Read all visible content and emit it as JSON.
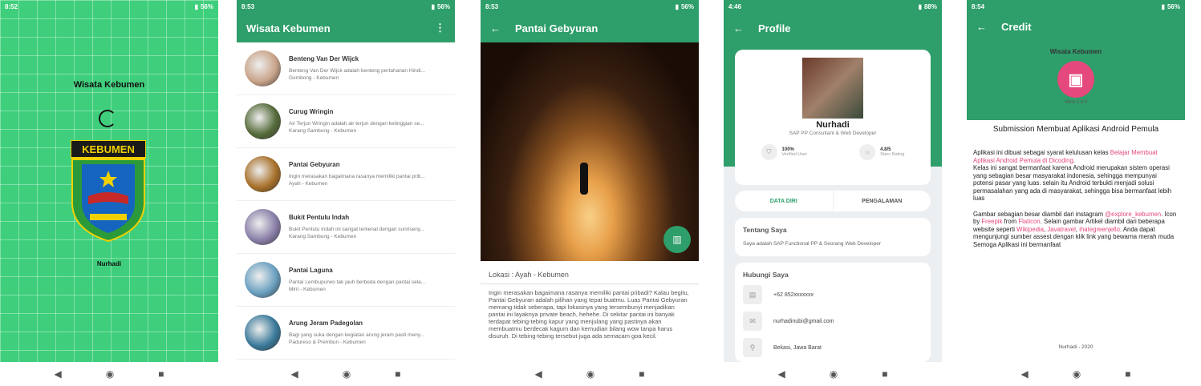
{
  "splash": {
    "status": {
      "time": "8:52",
      "battery": "56%"
    },
    "title": "Wisata Kebumen",
    "logo_text": "KEBUMEN",
    "author": "Nurhadi"
  },
  "list": {
    "status": {
      "time": "8:53",
      "battery": "56%"
    },
    "title": "Wisata Kebumen",
    "items": [
      {
        "title": "Benteng Van Der Wijck",
        "desc": "Benteng Van Der Wijck adalah benteng pertahanan Hindi...",
        "loc": "Gombong - Kebumen",
        "color": "#c9a48a"
      },
      {
        "title": "Curug Wringin",
        "desc": "Air Terjun Wringin adalah air terjun dengan ketinggian se...",
        "loc": "Karang Sambung - Kebumen",
        "color": "#556b3a"
      },
      {
        "title": "Pantai Gebyuran",
        "desc": "Ingin merasakan bagaimana rasanya memiliki pantai prib...",
        "loc": "Ayah - Kebumen",
        "color": "#a8702a"
      },
      {
        "title": "Bukit Pentulu Indah",
        "desc": "Bukit Pentulu Indah ini sangat terkenal dengan sunriseny...",
        "loc": "Karang Sambung - Kebumen",
        "color": "#8a7fa8"
      },
      {
        "title": "Pantai Laguna",
        "desc": "Pantai Lembupurwo tak jauh berbeda dengan pantai sela...",
        "loc": "Mirit - Kebumen",
        "color": "#6aa0c0"
      },
      {
        "title": "Arung Jeram Padegolan",
        "desc": "Bagi yang suka dengan kegiatan arung jeram pasti meny...",
        "loc": "Padureso & Prembun - Kebumen",
        "color": "#3a7a9a"
      }
    ]
  },
  "detail": {
    "status": {
      "time": "8:53",
      "battery": "56%"
    },
    "title": "Pantai Gebyuran",
    "location": "Lokasi : Ayah - Kebumen",
    "description": "Ingin merasakan bagaimana rasanya memiliki pantai pribadi? Kalau begitu, Pantai Gebyuran adalah pilihan yang tepat buatmu. Luas Pantai Gebyuran memang tidak seberapa, tapi lokasinya yang tersembunyi menjadikan pantai ini layaknya private beach, hehehe. Di sekitar pantai ini banyak terdapat tebing-tebing kapur yang menjulang yang pastinya akan membuatmu berdecak kagum dan kemudian bilang wow tanpa harus disuruh. Di tebing-tebing tersebut juga ada semacam goa kecil."
  },
  "profile": {
    "status": {
      "time": "4:46",
      "battery": "88%"
    },
    "title": "Profile",
    "name": "Nurhadi",
    "role": "SAP PP Consultant & Web Developer",
    "stat1_value": "100%",
    "stat1_label": "Verified User",
    "stat2_value": "4.8/5",
    "stat2_label": "Stars Rating",
    "tab1": "DATA DIRI",
    "tab2": "PENGALAMAN",
    "about_title": "Tentang Saya",
    "about_text": "Saya adalah SAP Functional PP & Seorang Web Developer",
    "contact_title": "Hubungi Saya",
    "phone": "+62 852xxxxxxx",
    "email": "nurhadinubi@gmail.com",
    "address": "Bekasi, Jawa Barat"
  },
  "credit": {
    "status": {
      "time": "8:54",
      "battery": "56%"
    },
    "title": "Credit",
    "app_name": "Wisata Kebumen",
    "version": "Versi 1.0.0",
    "heading": "Submission Membuat Aplikasi Android Pemula",
    "p1a": "Aplikasi ini dibuat sebagai syarat kelulusan kelas ",
    "p1link": "Belajar Membuat Aplikasi Android Pemula di Dicoding",
    "p1b": ".",
    "p2": "Kelas ini sangat bermanfaat karena Android merupakan sistem operasi yang sebagian besar masyarakat indonesia, sehingga mempunyai potensi pasar yang luas. selain itu Android terbukti menjadi solusi permasalahan yang ada di masyarakat, sehingga bisa bermanfaat lebih luas",
    "p3a": "Gambar sebagian besar diambil dari instagram ",
    "p3link1": "@explore_kebumen",
    "p3b": ". Icon by ",
    "p3link2": "Freepik",
    "p3c": " from ",
    "p3link3": "Flaticon",
    "p3d": ". Selain gambar Artikel diambil dari beberapa website seperti ",
    "p3link4": "Wikipedia",
    "p3e": ", ",
    "p3link5": "Javatravel",
    "p3f": ", ",
    "p3link6": "ihategreenjello",
    "p3g": ". Anda dapat mengunjungi sumber assest dengan klik link yang bewarna merah muda",
    "p4": "Semoga Aplikasi ini bermanfaat",
    "footer": "Nurhadi - 2020"
  },
  "colors": {
    "primary": "#2e9e6a",
    "splash_bg": "#3fcf7c",
    "link": "#e5487c"
  }
}
